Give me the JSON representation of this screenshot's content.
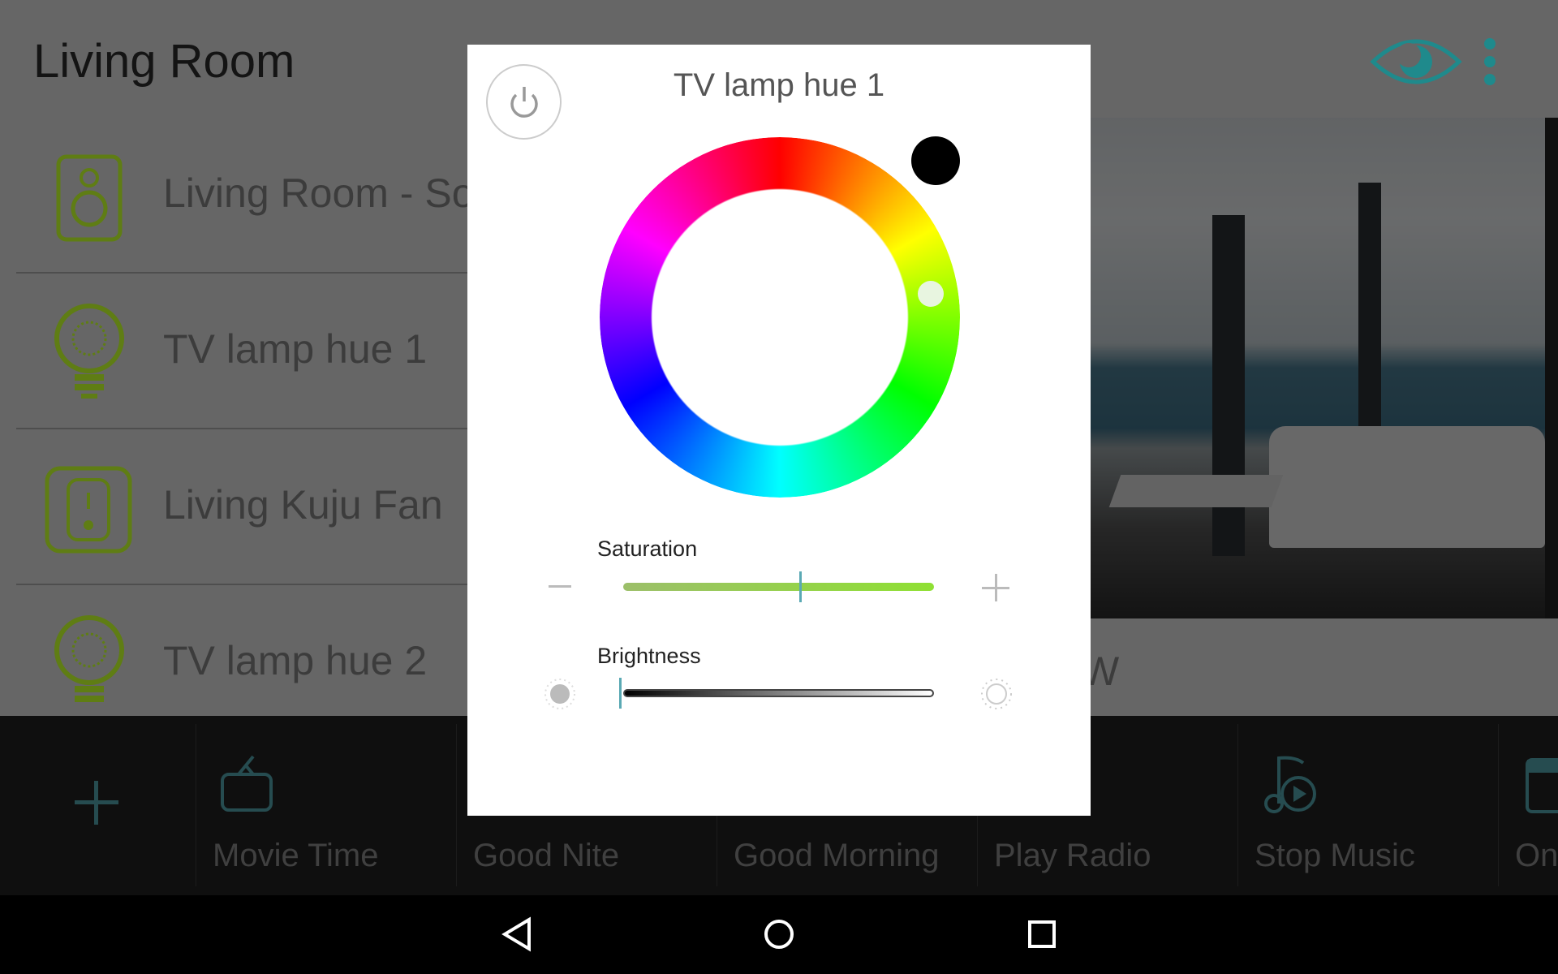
{
  "header": {
    "title": "Living Room",
    "eye_icon": "eye-icon",
    "menu_icon": "more-vert-icon",
    "accent": "#2aa7a9"
  },
  "devices": [
    {
      "label": "Living Room - Sonos",
      "icon": "speaker-icon"
    },
    {
      "label": "TV lamp hue 1",
      "icon": "bulb-icon"
    },
    {
      "label": "Living Kuju Fan",
      "icon": "switch-icon"
    },
    {
      "label": "TV lamp hue 2",
      "icon": "bulb-icon"
    }
  ],
  "room_panel": {
    "partial_text": "W"
  },
  "scenes": [
    {
      "label": "",
      "icon": "plus-icon"
    },
    {
      "label": "Movie Time",
      "icon": "tv-icon"
    },
    {
      "label": "Good Nite",
      "icon": ""
    },
    {
      "label": "Good Morning",
      "icon": ""
    },
    {
      "label": "Play Radio",
      "icon": ""
    },
    {
      "label": "Stop Music",
      "icon": "music-play-icon"
    },
    {
      "label": "On",
      "icon": "clapper-icon"
    }
  ],
  "dialog": {
    "title": "TV lamp hue 1",
    "power_icon": "power-icon",
    "selected_color": "#000000",
    "saturation": {
      "label": "Saturation",
      "value": 0.57
    },
    "brightness": {
      "label": "Brightness",
      "value": 0.0
    }
  },
  "navbar": {
    "back": "back-icon",
    "home": "home-icon",
    "recents": "recents-icon"
  }
}
